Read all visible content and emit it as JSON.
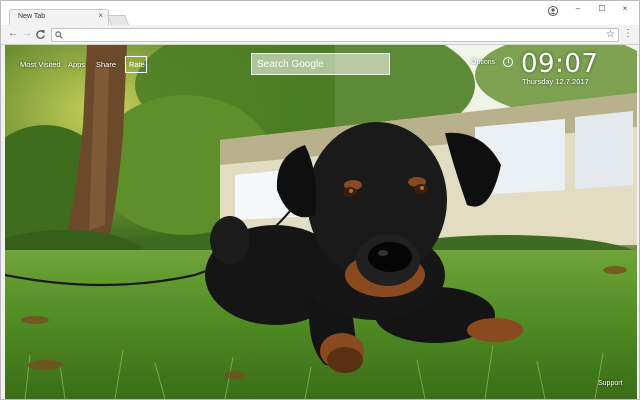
{
  "browser": {
    "tab_title": "New Tab",
    "tab_close": "×",
    "window_controls": [
      "–",
      "☐",
      "×"
    ],
    "account_icon": "account-icon",
    "nav": {
      "back": "←",
      "forward": "→",
      "reload": "C"
    },
    "omnibox": {
      "value": "",
      "icon": "search-icon"
    },
    "bookmark_star": "☆",
    "menu": "⋮"
  },
  "page": {
    "links": [
      "Most Visited",
      "Apps",
      "Share",
      "Rate"
    ],
    "search_placeholder": "Search Google",
    "options_label": "Options",
    "time": "09:07",
    "date": "Thursday  12.7.2017",
    "support_label": "Support"
  },
  "colors": {
    "sky": "#e6f0d8",
    "grass": "#4f8a22",
    "foliage": "#3c6b1f",
    "dog_fur": "#121212",
    "dog_tan": "#8a4a1f"
  }
}
